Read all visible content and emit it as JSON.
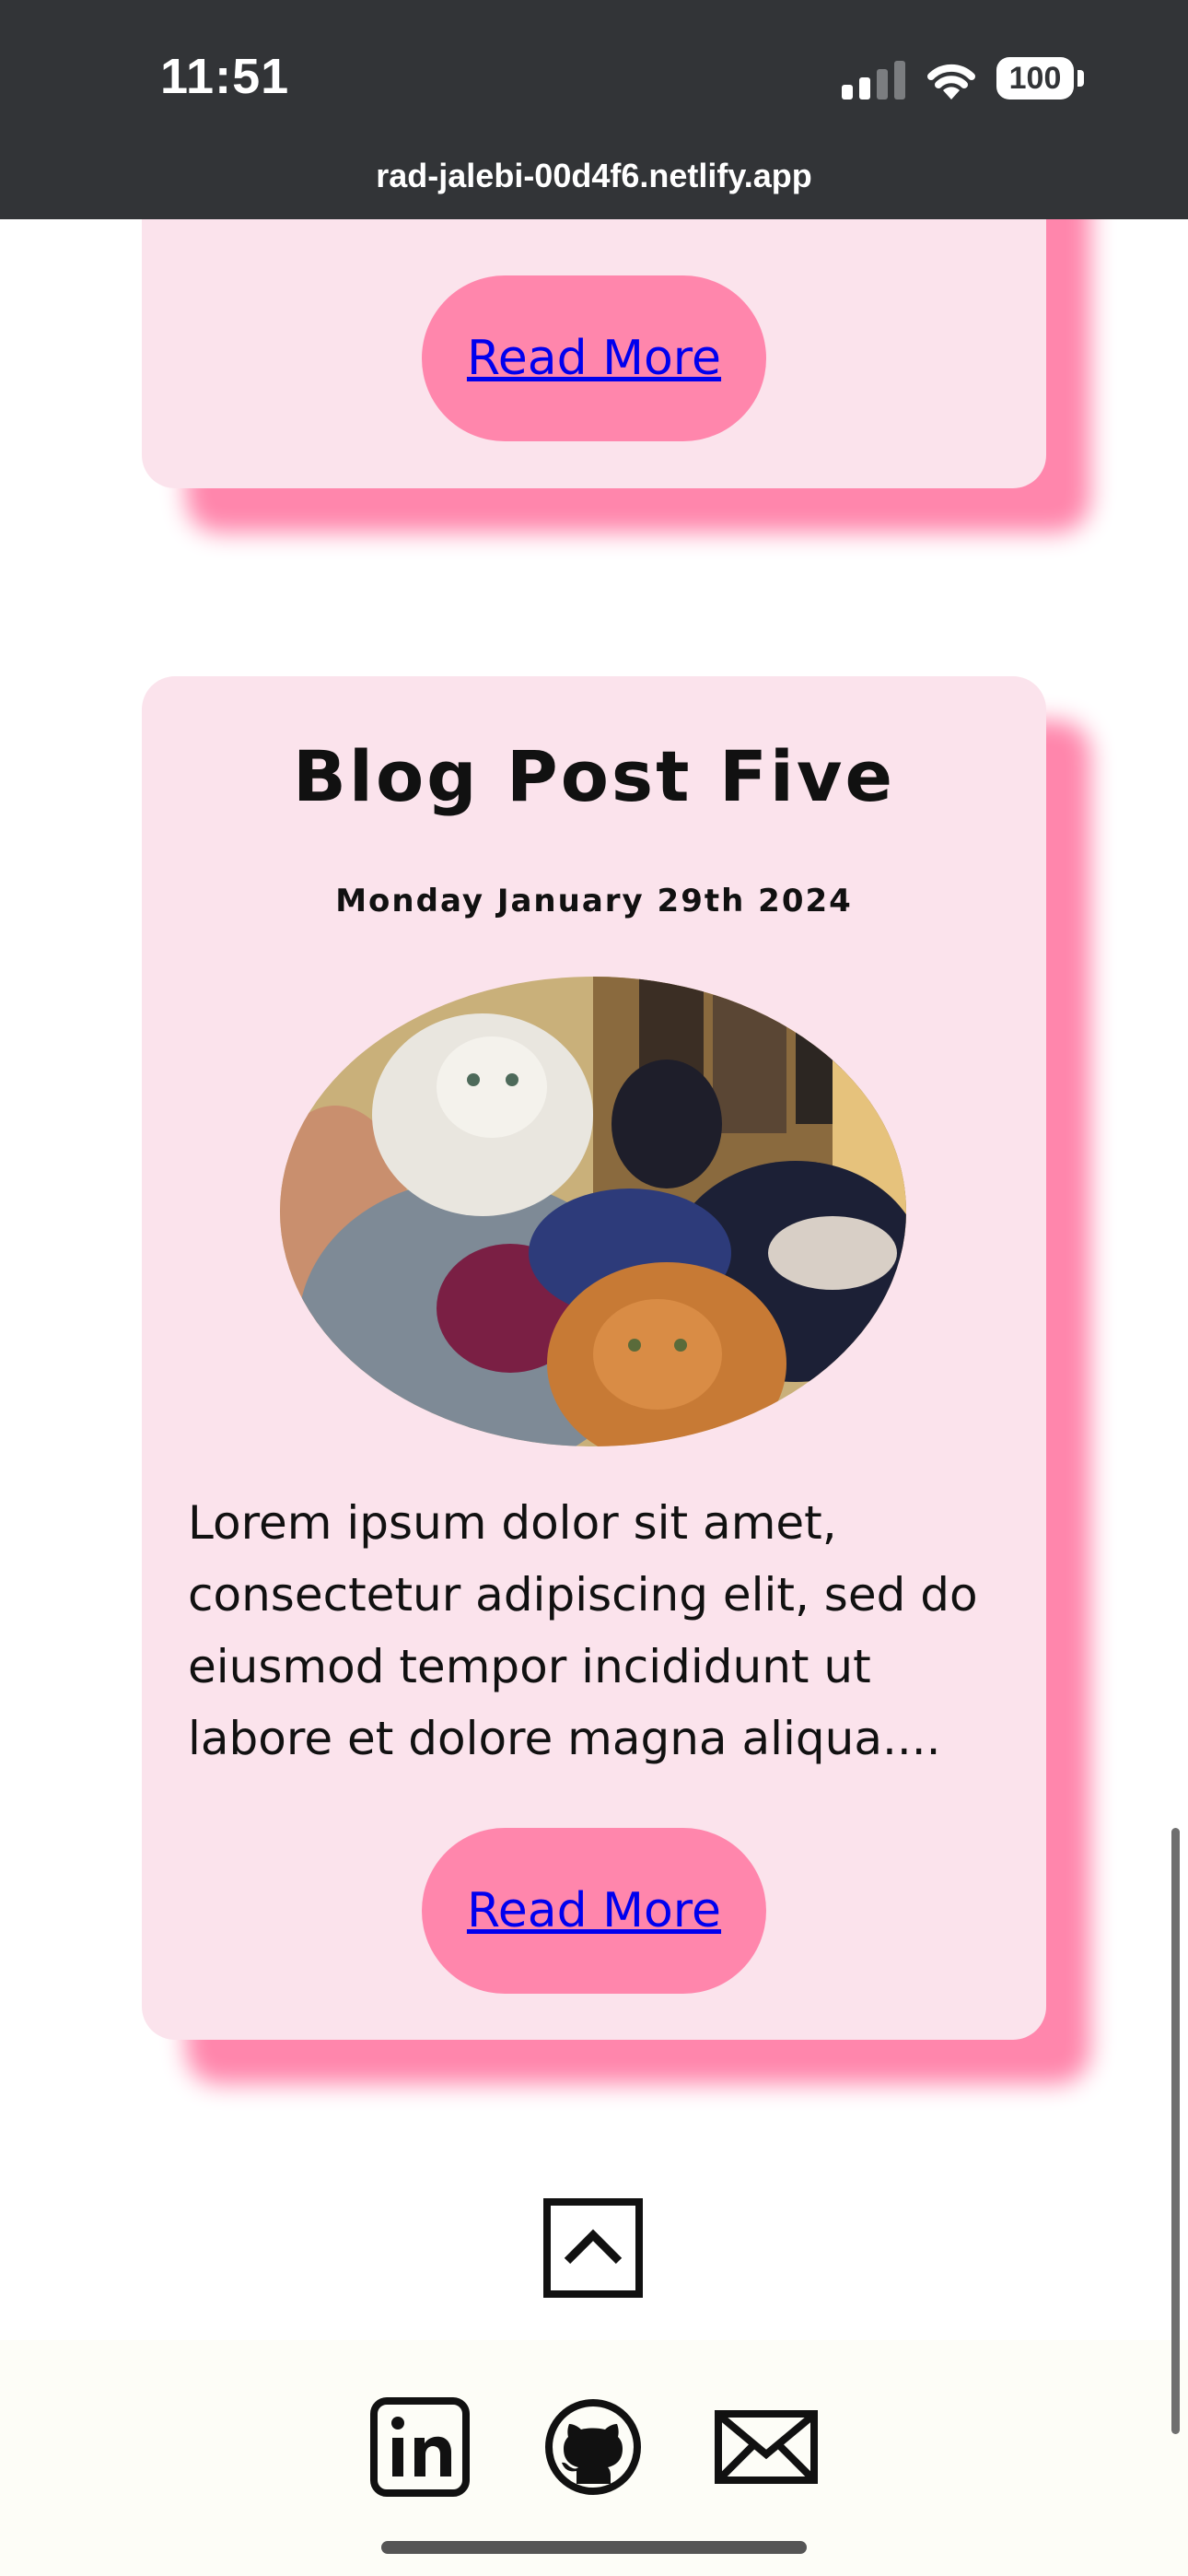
{
  "status_bar": {
    "time": "11:51",
    "battery": "100",
    "url": "rad-jalebi-00d4f6.netlify.app"
  },
  "previous_card": {
    "read_more_label": "Read More"
  },
  "post": {
    "title": "Blog Post Five",
    "date": "Monday January 29th 2024",
    "excerpt": "Lorem ipsum dolor sit amet, consectetur adipiscing elit, sed do eiusmod tempor incididunt ut labore et dolore magna aliqua....",
    "read_more_label": "Read More"
  },
  "footer": {
    "icons": [
      "chevron-up-icon",
      "linkedin-icon",
      "github-icon",
      "mail-icon"
    ]
  },
  "colors": {
    "card_background": "#fbe3ec",
    "accent_pink": "#ff86ac",
    "link": "#0000ee",
    "status_bar": "#323437"
  }
}
